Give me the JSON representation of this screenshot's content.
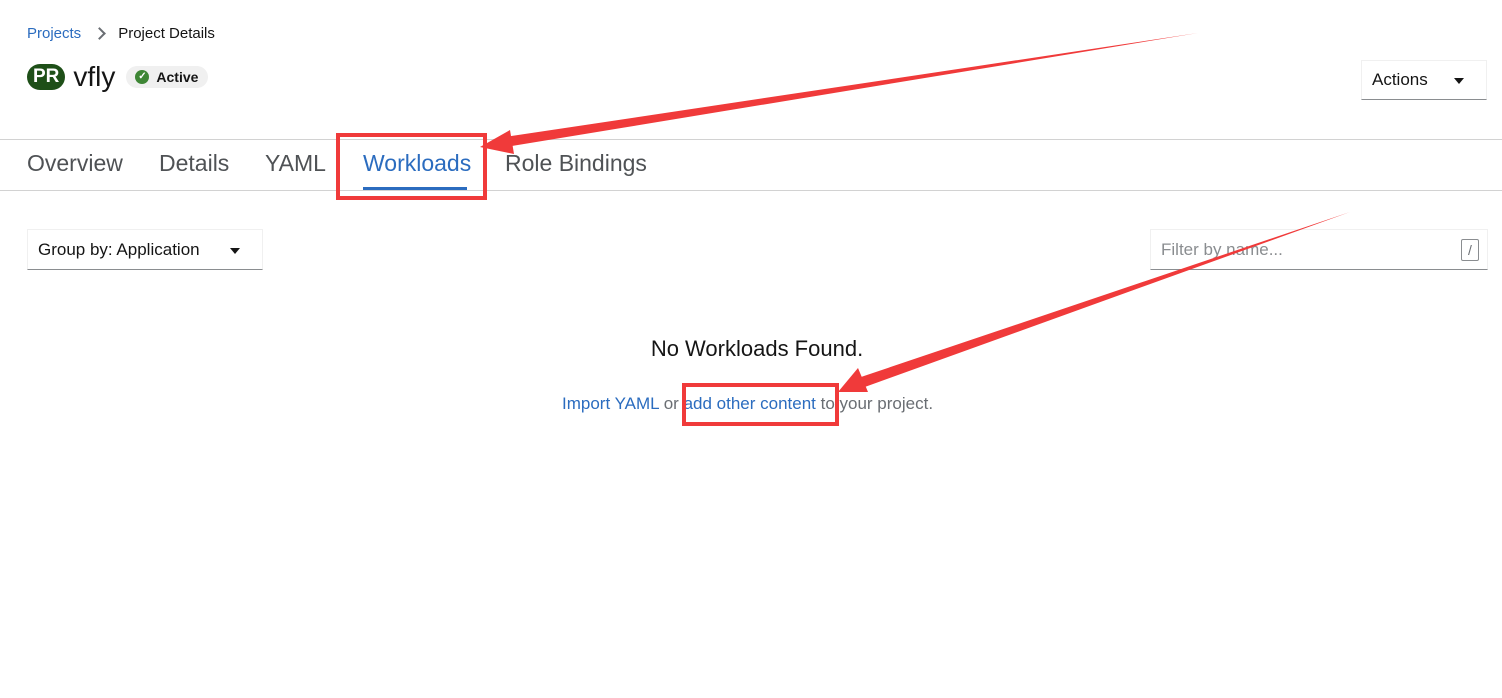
{
  "breadcrumb": {
    "parent": "Projects",
    "current": "Project Details"
  },
  "project": {
    "badge": "PR",
    "name": "vfly",
    "status": "Active"
  },
  "actions": {
    "label": "Actions"
  },
  "tabs": [
    {
      "label": "Overview",
      "active": false
    },
    {
      "label": "Details",
      "active": false
    },
    {
      "label": "YAML",
      "active": false
    },
    {
      "label": "Workloads",
      "active": true
    },
    {
      "label": "Role Bindings",
      "active": false
    }
  ],
  "toolbar": {
    "group_by": "Group by: Application",
    "filter_placeholder": "Filter by name...",
    "filter_shortcut": "/"
  },
  "empty_state": {
    "title": "No Workloads Found.",
    "import_link": "Import YAML",
    "or_text": " or ",
    "add_link": "add other content",
    "suffix": " to your project."
  },
  "colors": {
    "link": "#2b6cbf",
    "pr_badge": "#1e4f18",
    "status_ok": "#3e8635",
    "annotation": "#f03a3a"
  }
}
